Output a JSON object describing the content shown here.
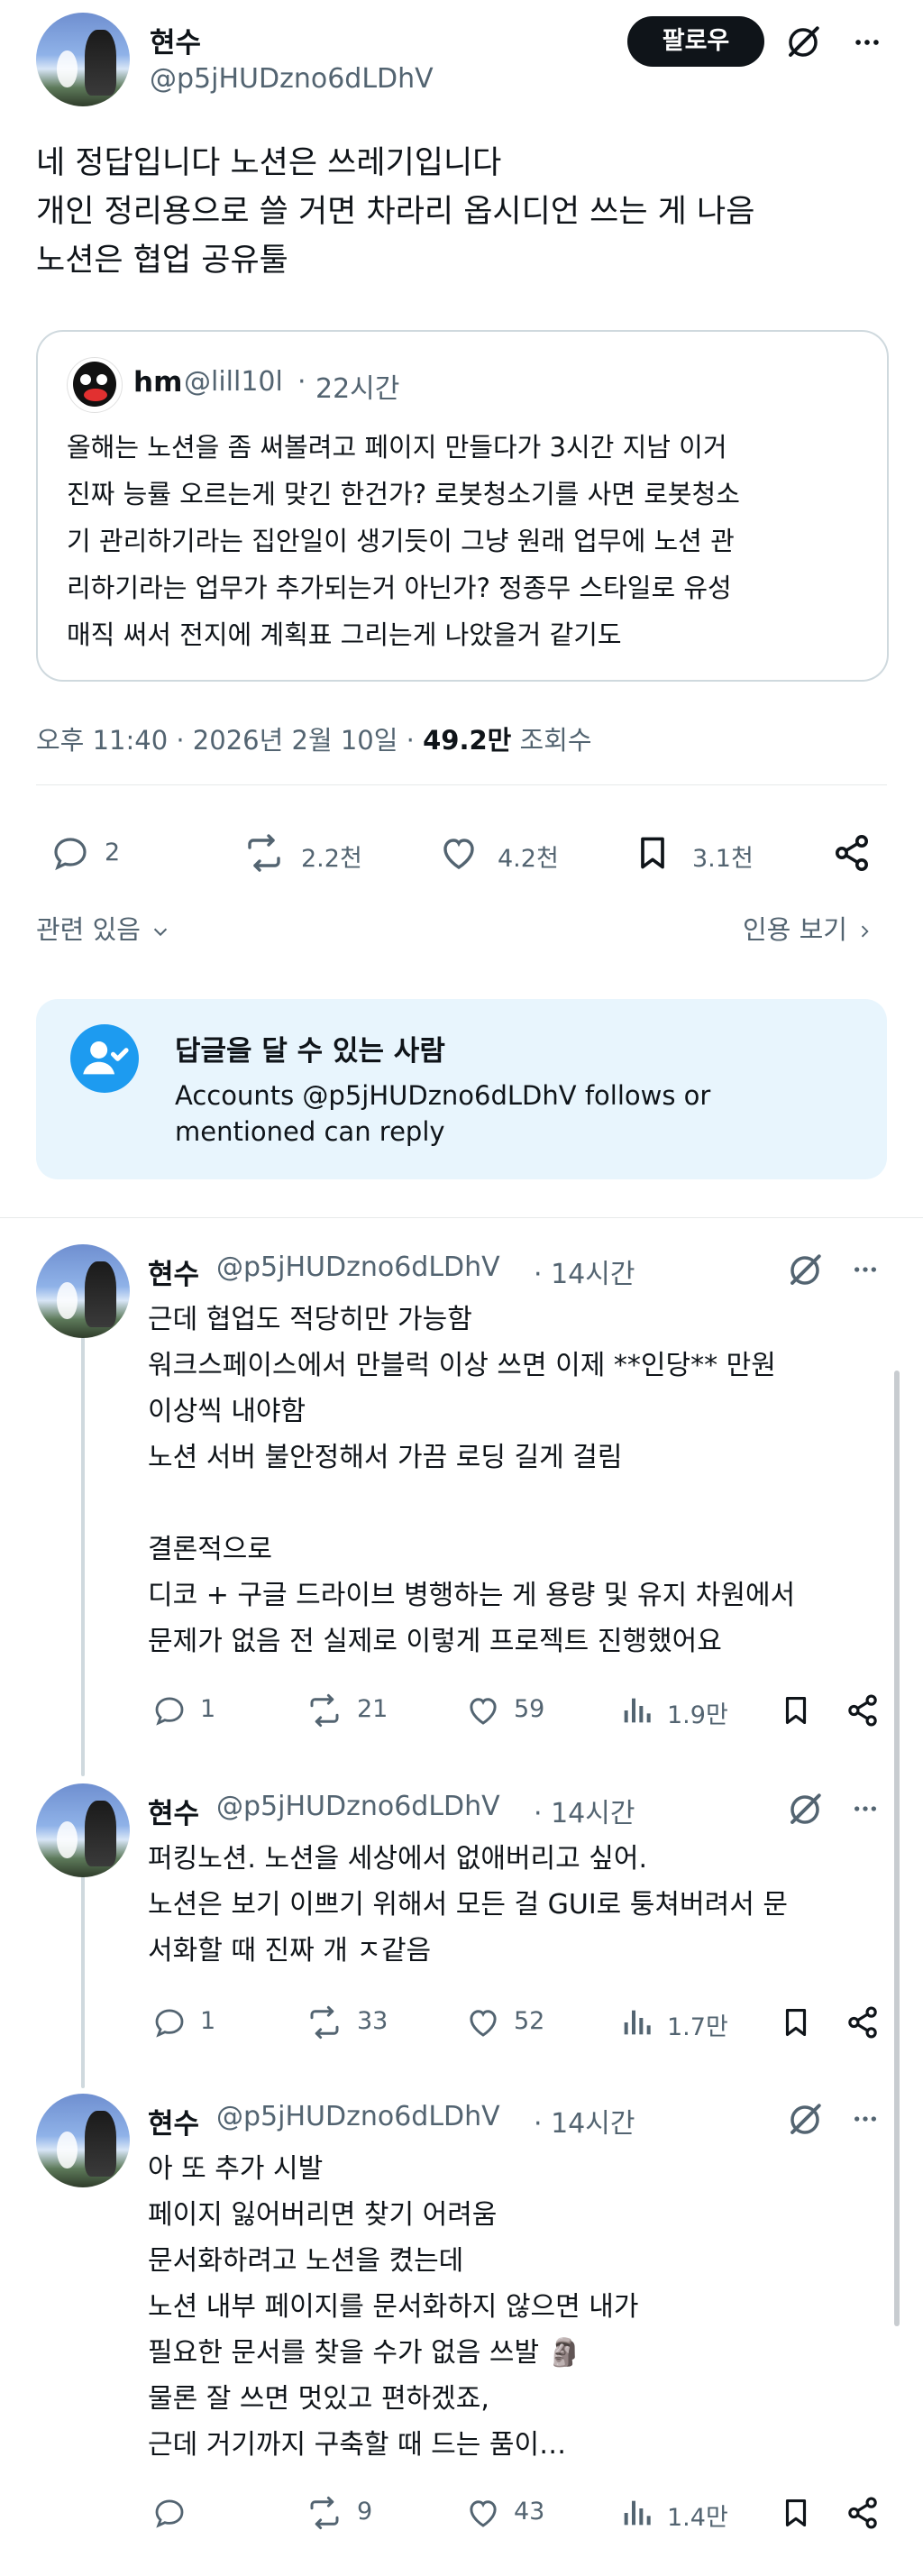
{
  "main_post": {
    "author_name": "현수",
    "author_handle": "@p5jHUDzno6dLDhV",
    "follow_label": "팔로우",
    "text_lines": [
      "네 정답입니다 노션은 쓰레기입니다",
      "개인 정리용으로 쓸 거면 차라리 옵시디언 쓰는 게 나음",
      "노션은 협업 공유툴"
    ],
    "quoted": {
      "author_name": "hm",
      "author_handle": "@lill10l",
      "time": "22시간",
      "text_lines": [
        "올해는 노션을 좀 써볼려고 페이지 만들다가 3시간 지남 이거",
        "진짜 능률 오르는게 맞긴 한건가? 로봇청소기를 사면 로봇청소",
        "기 관리하기라는 집안일이 생기듯이 그냥 원래 업무에 노션 관",
        "리하기라는 업무가 추가되는거 아닌가? 정종무 스타일로 유성",
        "매직 써서 전지에 계획표 그리는게 나았을거 같기도"
      ]
    },
    "meta_time": "오후 11:40 · 2026년 2월 10일 · ",
    "meta_views_count": "49.2만",
    "meta_views_label": " 조회수",
    "actions": {
      "replies": "2",
      "reposts": "2.2천",
      "likes": "4.2천",
      "bookmarks": "3.1천"
    },
    "related_label": "관련 있음",
    "quotes_label": "인용 보기"
  },
  "reply_restriction": {
    "title": "답글을 달 수 있는 사람",
    "desc_line1": "Accounts @p5jHUDzno6dLDhV follows or",
    "desc_line2": "mentioned can reply"
  },
  "replies": [
    {
      "author_name": "현수",
      "author_handle": "@p5jHUDzno6dLDhV",
      "time": "· 14시간",
      "text_lines": [
        "근데 협업도 적당히만 가능함",
        "워크스페이스에서 만블럭 이상 쓰면 이제 **인당** 만원",
        "이상씩 내야함",
        "노션 서버 불안정해서 가끔 로딩 길게 걸림",
        "",
        "결론적으로",
        "디코 + 구글 드라이브 병행하는 게 용량 및 유지 차원에서",
        "문제가 없음 전 실제로 이렇게 프로젝트 진행했어요"
      ],
      "replies": "1",
      "reposts": "21",
      "likes": "59",
      "views": "1.9만"
    },
    {
      "author_name": "현수",
      "author_handle": "@p5jHUDzno6dLDhV",
      "time": "· 14시간",
      "text_lines": [
        "퍼킹노션. 노션을 세상에서 없애버리고 싶어.",
        "노션은 보기 이쁘기 위해서 모든 걸 GUI로 퉁쳐버려서 문",
        "서화할 때 진짜 개 ㅈ같음"
      ],
      "replies": "1",
      "reposts": "33",
      "likes": "52",
      "views": "1.7만"
    },
    {
      "author_name": "현수",
      "author_handle": "@p5jHUDzno6dLDhV",
      "time": "· 14시간",
      "text_lines": [
        "아 또 추가 시발",
        "페이지 잃어버리면 찾기 어려움",
        "문서화하려고 노션을 켰는데",
        "노션 내부 페이지를 문서화하지 않으면 내가",
        "필요한 문서를 찾을 수가 없음 쓰발 🗿",
        "물론 잘 쓰면 멋있고 편하겠죠,",
        "근데 거기까지 구축할 때 드는 품이…"
      ],
      "replies": "",
      "reposts": "9",
      "likes": "43",
      "views": "1.4만"
    }
  ],
  "icons": [
    "grok-icon",
    "more-icon",
    "reply-icon",
    "repost-icon",
    "like-icon",
    "bookmark-icon",
    "share-icon",
    "views-icon",
    "chevron-down-icon",
    "chevron-right-icon",
    "person-check-icon"
  ],
  "colors": {
    "accent": "#1d9bf0",
    "text": "#0f1419",
    "muted": "#536471",
    "info_bg": "#e8f5fd"
  }
}
